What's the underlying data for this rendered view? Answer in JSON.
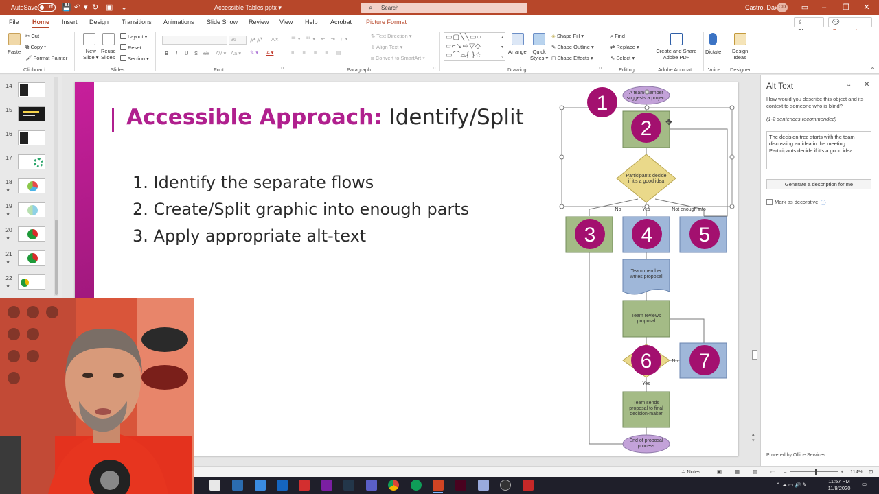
{
  "titlebar": {
    "autosave_label": "AutoSave",
    "autosave_state": "Off",
    "filename": "Accessible Tables.pptx ▾",
    "search_placeholder": "Search",
    "user_name": "Castro, Dax",
    "user_initials": "CD",
    "bg_color": "#b7472a"
  },
  "tabs": [
    {
      "label": "File"
    },
    {
      "label": "Home"
    },
    {
      "label": "Insert"
    },
    {
      "label": "Design"
    },
    {
      "label": "Transitions"
    },
    {
      "label": "Animations"
    },
    {
      "label": "Slide Show"
    },
    {
      "label": "Review"
    },
    {
      "label": "View"
    },
    {
      "label": "Help"
    },
    {
      "label": "Acrobat"
    },
    {
      "label": "Picture Format"
    }
  ],
  "tab_buttons": {
    "share": "Share",
    "comments": "Comments"
  },
  "ribbon": {
    "clipboard": {
      "paste": "Paste",
      "cut": "Cut",
      "copy": "Copy",
      "format_painter": "Format Painter",
      "label": "Clipboard"
    },
    "slides": {
      "new_slide": "New Slide",
      "reuse_slides": "Reuse Slides",
      "layout": "Layout",
      "reset": "Reset",
      "section": "Section",
      "label": "Slides",
      "new_slide_line1": "New",
      "new_slide_line2": "Slide ▾",
      "reuse_line1": "Reuse",
      "reuse_line2": "Slides"
    },
    "font": {
      "label": "Font",
      "size": "36"
    },
    "paragraph": {
      "label": "Paragraph",
      "text_direction": "Text Direction",
      "align_text": "Align Text",
      "smartart": "Convert to SmartArt"
    },
    "drawing": {
      "label": "Drawing",
      "arrange": "Arrange",
      "quick_styles_1": "Quick",
      "quick_styles_2": "Styles ▾",
      "shape_fill": "Shape Fill",
      "shape_outline": "Shape Outline",
      "shape_effects": "Shape Effects"
    },
    "editing": {
      "label": "Editing",
      "find": "Find",
      "replace": "Replace",
      "select": "Select"
    },
    "adobe": {
      "label": "Adobe Acrobat",
      "line1": "Create and Share",
      "line2": "Adobe PDF"
    },
    "voice": {
      "label": "Voice",
      "dictate": "Dictate"
    },
    "designer": {
      "label": "Designer",
      "line1": "Design",
      "line2": "Ideas"
    }
  },
  "thumbnails": [
    {
      "num": "14",
      "star": ""
    },
    {
      "num": "15",
      "star": ""
    },
    {
      "num": "16",
      "star": ""
    },
    {
      "num": "17",
      "star": ""
    },
    {
      "num": "18",
      "star": "★"
    },
    {
      "num": "19",
      "star": "★"
    },
    {
      "num": "20",
      "star": "★"
    },
    {
      "num": "21",
      "star": "★"
    },
    {
      "num": "22",
      "star": "★"
    }
  ],
  "slide": {
    "title_accent": "Accessible Approach:",
    "title_rest": "Identify/Split",
    "steps": [
      "1. Identify the separate flows",
      "2. Create/Split graphic into enough parts",
      "3. Apply appropriate alt-text"
    ],
    "accent_color": "#b0208e"
  },
  "flowchart": {
    "start": [
      "A team member",
      "suggests a project"
    ],
    "decision": [
      "Participants decide",
      "if it's a good idea"
    ],
    "branch_no": "No",
    "branch_yes": "Yes",
    "branch_more": "Not enough info",
    "writes": [
      "Team member",
      "writes proposal"
    ],
    "reviews": [
      "Team reviews",
      "proposal"
    ],
    "decision2_yes": "Yes",
    "decision2_no": "No",
    "sends": [
      "Team sends",
      "proposal to final",
      "decision-maker"
    ],
    "end": [
      "End of proposal",
      "process"
    ],
    "markers": [
      "1",
      "2",
      "3",
      "4",
      "5",
      "6",
      "7"
    ],
    "marker_color": "#a3106f"
  },
  "alt_text": {
    "title": "Alt Text",
    "question": "How would you describe this object and its context to someone who is blind?",
    "hint": "(1-2 sentences recommended)",
    "value": "The decision tree starts with the team discussing an idea in the meeting. Participants decide if it's a good idea.",
    "generate_button": "Generate a description for me",
    "decorative_label": "Mark as decorative",
    "powered_by": "Powered by Office Services"
  },
  "statusbar": {
    "notes": "Notes",
    "zoom": "114%"
  },
  "taskbar": {
    "time": "11:57 PM",
    "date": "11/9/2020"
  }
}
